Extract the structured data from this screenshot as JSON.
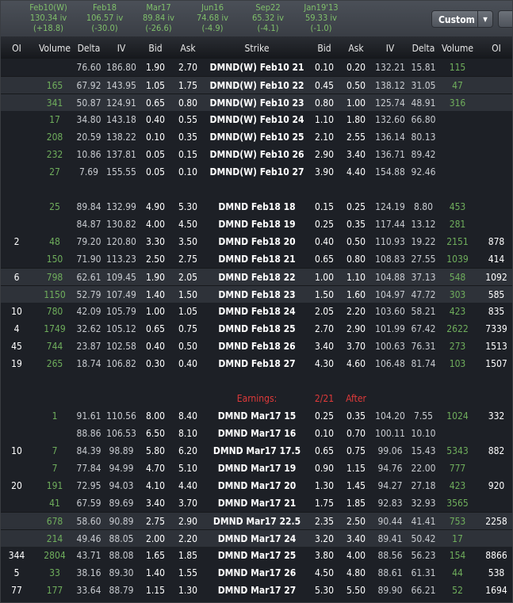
{
  "expirations": [
    {
      "label": "Feb10(W)",
      "iv": "130.34 iv",
      "change": "(+18.8)"
    },
    {
      "label": "Feb18",
      "iv": "106.57 iv",
      "change": "(-30.0)"
    },
    {
      "label": "Mar17",
      "iv": "89.84 iv",
      "change": "(-26.6)"
    },
    {
      "label": "Jun16",
      "iv": "74.68 iv",
      "change": "(-4.9)"
    },
    {
      "label": "Sep22",
      "iv": "65.32 iv",
      "change": "(-4.1)"
    },
    {
      "label": "Jan19'13",
      "iv": "59.33 iv",
      "change": "(-1.0)"
    }
  ],
  "toolbar": {
    "custom_label": "Custom",
    "dropdown_icon": "▼"
  },
  "columns": [
    "OI",
    "Volume",
    "Delta",
    "IV",
    "Bid",
    "Ask",
    "Strike",
    "Bid",
    "Ask",
    "IV",
    "Delta",
    "Volume",
    "OI"
  ],
  "colors": {
    "positive": "#6fae5c",
    "earnings": "#e03a3a",
    "highlight_row": "#2e3239"
  },
  "earnings": {
    "label": "Earnings:",
    "date": "2/21",
    "timing": "After"
  },
  "rows": [
    {
      "hl": false,
      "cells": [
        "",
        "",
        "76.60",
        "186.80",
        "1.90",
        "2.70",
        "DMND(W) Feb10 21",
        "0.10",
        "0.20",
        "132.21",
        "15.81",
        "115",
        ""
      ]
    },
    {
      "hl": true,
      "cells": [
        "",
        "165",
        "67.92",
        "143.95",
        "1.05",
        "1.75",
        "DMND(W) Feb10 22",
        "0.45",
        "0.50",
        "138.12",
        "31.05",
        "47",
        ""
      ]
    },
    {
      "hl": true,
      "cells": [
        "",
        "341",
        "50.87",
        "124.91",
        "0.65",
        "0.80",
        "DMND(W) Feb10 23",
        "0.80",
        "1.00",
        "125.74",
        "48.91",
        "316",
        ""
      ]
    },
    {
      "hl": false,
      "cells": [
        "",
        "17",
        "34.80",
        "143.18",
        "0.40",
        "0.55",
        "DMND(W) Feb10 24",
        "1.10",
        "1.80",
        "132.60",
        "66.80",
        "",
        ""
      ]
    },
    {
      "hl": false,
      "cells": [
        "",
        "208",
        "20.59",
        "138.22",
        "0.10",
        "0.35",
        "DMND(W) Feb10 25",
        "2.10",
        "2.55",
        "136.14",
        "80.13",
        "",
        ""
      ]
    },
    {
      "hl": false,
      "cells": [
        "",
        "232",
        "10.86",
        "137.81",
        "0.05",
        "0.15",
        "DMND(W) Feb10 26",
        "2.90",
        "3.40",
        "136.71",
        "89.42",
        "",
        ""
      ]
    },
    {
      "hl": false,
      "cells": [
        "",
        "27",
        "7.69",
        "155.55",
        "0.05",
        "0.10",
        "DMND(W) Feb10 27",
        "3.90",
        "4.40",
        "154.88",
        "92.46",
        "",
        ""
      ]
    },
    null,
    {
      "hl": false,
      "cells": [
        "",
        "25",
        "89.84",
        "132.99",
        "4.90",
        "5.30",
        "DMND Feb18 18",
        "0.15",
        "0.25",
        "124.19",
        "8.80",
        "453",
        ""
      ]
    },
    {
      "hl": false,
      "cells": [
        "",
        "",
        "84.87",
        "130.82",
        "4.00",
        "4.50",
        "DMND Feb18 19",
        "0.25",
        "0.35",
        "117.44",
        "13.12",
        "281",
        ""
      ]
    },
    {
      "hl": false,
      "cells": [
        "2",
        "48",
        "79.20",
        "120.80",
        "3.30",
        "3.50",
        "DMND Feb18 20",
        "0.40",
        "0.50",
        "110.93",
        "19.22",
        "2151",
        "878"
      ]
    },
    {
      "hl": false,
      "cells": [
        "",
        "150",
        "71.90",
        "113.23",
        "2.50",
        "2.75",
        "DMND Feb18 21",
        "0.65",
        "0.80",
        "108.83",
        "27.55",
        "1039",
        "414"
      ]
    },
    {
      "hl": true,
      "cells": [
        "6",
        "798",
        "62.61",
        "109.45",
        "1.90",
        "2.05",
        "DMND Feb18 22",
        "1.00",
        "1.10",
        "104.88",
        "37.13",
        "548",
        "1092"
      ]
    },
    {
      "hl": true,
      "cells": [
        "",
        "1150",
        "52.79",
        "107.49",
        "1.40",
        "1.50",
        "DMND Feb18 23",
        "1.50",
        "1.60",
        "104.97",
        "47.72",
        "303",
        "585"
      ]
    },
    {
      "hl": false,
      "cells": [
        "10",
        "780",
        "42.09",
        "105.79",
        "1.00",
        "1.05",
        "DMND Feb18 24",
        "2.05",
        "2.20",
        "103.60",
        "58.21",
        "423",
        "835"
      ]
    },
    {
      "hl": false,
      "cells": [
        "4",
        "1749",
        "32.62",
        "105.12",
        "0.65",
        "0.75",
        "DMND Feb18 25",
        "2.70",
        "2.90",
        "101.99",
        "67.42",
        "2622",
        "7339"
      ]
    },
    {
      "hl": false,
      "cells": [
        "45",
        "744",
        "23.87",
        "102.58",
        "0.40",
        "0.50",
        "DMND Feb18 26",
        "3.40",
        "3.70",
        "100.63",
        "76.31",
        "273",
        "1513"
      ]
    },
    {
      "hl": false,
      "cells": [
        "19",
        "265",
        "18.74",
        "106.82",
        "0.30",
        "0.40",
        "DMND Feb18 27",
        "4.30",
        "4.60",
        "106.48",
        "81.74",
        "103",
        "1507"
      ]
    },
    null,
    "earnings",
    {
      "hl": false,
      "cells": [
        "",
        "1",
        "91.61",
        "110.56",
        "8.00",
        "8.40",
        "DMND Mar17 15",
        "0.25",
        "0.35",
        "104.20",
        "7.55",
        "1024",
        "332"
      ]
    },
    {
      "hl": false,
      "cells": [
        "",
        "",
        "88.86",
        "106.53",
        "6.50",
        "8.10",
        "DMND Mar17 16",
        "0.10",
        "0.70",
        "100.11",
        "10.10",
        "",
        ""
      ]
    },
    {
      "hl": false,
      "cells": [
        "10",
        "7",
        "84.39",
        "98.89",
        "5.80",
        "6.20",
        "DMND Mar17 17.5",
        "0.65",
        "0.75",
        "99.06",
        "15.43",
        "5343",
        "882"
      ]
    },
    {
      "hl": false,
      "cells": [
        "",
        "7",
        "77.84",
        "94.99",
        "4.70",
        "5.10",
        "DMND Mar17 19",
        "0.90",
        "1.15",
        "94.76",
        "22.00",
        "777",
        ""
      ]
    },
    {
      "hl": false,
      "cells": [
        "20",
        "191",
        "72.95",
        "94.03",
        "4.10",
        "4.40",
        "DMND Mar17 20",
        "1.30",
        "1.45",
        "94.27",
        "27.18",
        "423",
        "920"
      ]
    },
    {
      "hl": false,
      "cells": [
        "",
        "41",
        "67.59",
        "89.69",
        "3.40",
        "3.70",
        "DMND Mar17 21",
        "1.75",
        "1.85",
        "92.83",
        "32.93",
        "3565",
        ""
      ]
    },
    {
      "hl": true,
      "cells": [
        "",
        "678",
        "58.60",
        "90.89",
        "2.75",
        "2.90",
        "DMND Mar17 22.5",
        "2.35",
        "2.50",
        "90.44",
        "41.41",
        "753",
        "2258"
      ]
    },
    {
      "hl": true,
      "cells": [
        "",
        "214",
        "49.46",
        "88.05",
        "2.00",
        "2.20",
        "DMND Mar17 24",
        "3.20",
        "3.40",
        "89.41",
        "50.42",
        "17",
        ""
      ]
    },
    {
      "hl": false,
      "cells": [
        "344",
        "2804",
        "43.71",
        "88.08",
        "1.65",
        "1.85",
        "DMND Mar17 25",
        "3.80",
        "4.00",
        "88.56",
        "56.23",
        "154",
        "8866"
      ]
    },
    {
      "hl": false,
      "cells": [
        "5",
        "33",
        "38.16",
        "89.30",
        "1.40",
        "1.55",
        "DMND Mar17 26",
        "4.50",
        "4.80",
        "88.61",
        "61.31",
        "44",
        "538"
      ]
    },
    {
      "hl": false,
      "cells": [
        "77",
        "177",
        "33.64",
        "88.79",
        "1.15",
        "1.30",
        "DMND Mar17 27",
        "5.30",
        "5.50",
        "89.90",
        "66.21",
        "52",
        "1694"
      ]
    }
  ]
}
